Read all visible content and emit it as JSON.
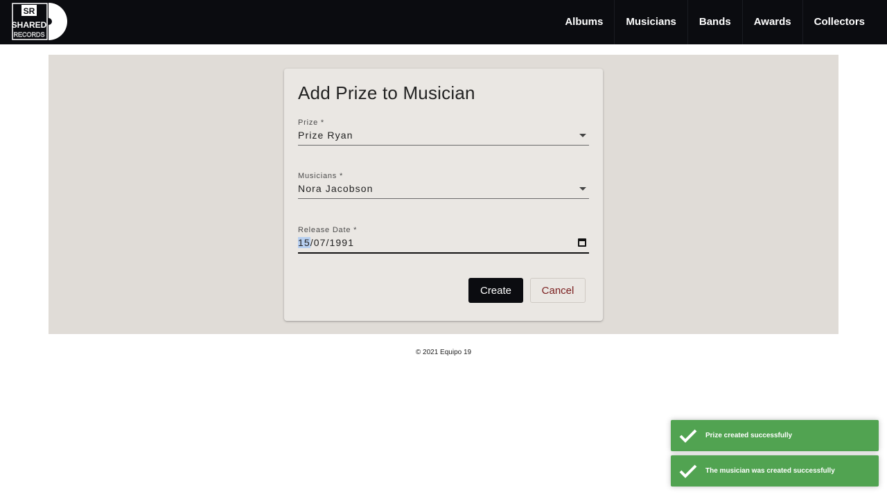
{
  "logo": {
    "line1": "SR",
    "line2": "SHARED",
    "line3": "RECORDS"
  },
  "nav": {
    "items": [
      "Albums",
      "Musicians",
      "Bands",
      "Awards",
      "Collectors"
    ]
  },
  "form": {
    "title": "Add Prize to Musician",
    "prize": {
      "label": "Prize *",
      "value": "Prize Ryan"
    },
    "musician": {
      "label": "Musicians *",
      "value": "Nora Jacobson"
    },
    "release_date": {
      "label": "Release Date *",
      "day": "15",
      "rest": "/07/1991"
    },
    "create_label": "Create",
    "cancel_label": "Cancel"
  },
  "footer": {
    "text": "© 2021 Equipo 19"
  },
  "toasts": [
    {
      "message": "Prize created successfully"
    },
    {
      "message": "The musician was created successfully"
    }
  ],
  "colors": {
    "navbar": "#0b0c10",
    "panel": "#e0dcd7",
    "card": "#eae7e3",
    "toast": "#51a351",
    "cancel_text": "#7a1e1e"
  }
}
